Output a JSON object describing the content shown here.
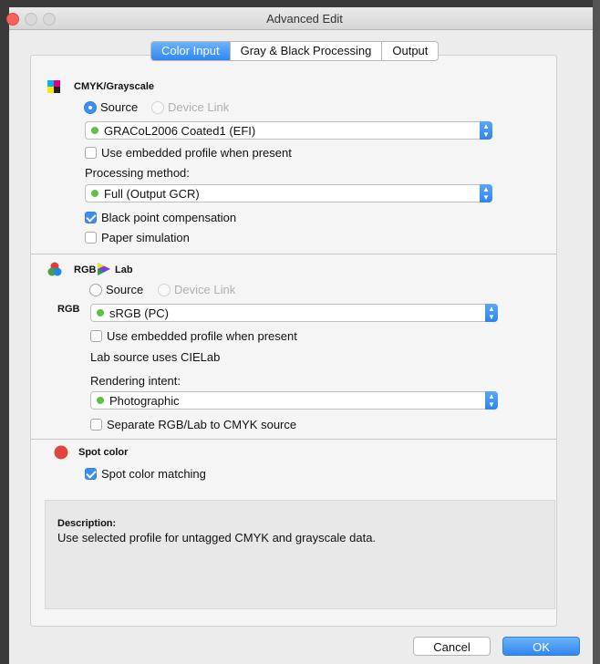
{
  "window": {
    "title": "Advanced Edit"
  },
  "tabs": [
    {
      "label": "Color Input",
      "active": true
    },
    {
      "label": "Gray & Black Processing",
      "active": false
    },
    {
      "label": "Output",
      "active": false
    }
  ],
  "cmyk": {
    "header": "CMYK/Grayscale",
    "source_label": "Source",
    "device_link_label": "Device Link",
    "profile": "GRACoL2006 Coated1 (EFI)",
    "use_embedded_label": "Use embedded profile when present",
    "use_embedded": false,
    "processing_method_label": "Processing method:",
    "processing_method": "Full (Output GCR)",
    "black_point_label": "Black point compensation",
    "black_point": true,
    "paper_sim_label": "Paper simulation",
    "paper_sim": false
  },
  "rgb": {
    "header_rgb": "RGB",
    "header_lab": "Lab",
    "source_label": "Source",
    "device_link_label": "Device Link",
    "row_label": "RGB",
    "profile": "sRGB (PC)",
    "use_embedded_label": "Use embedded profile when present",
    "lab_source_text": "Lab source uses CIELab",
    "rendering_intent_label": "Rendering intent:",
    "rendering_intent": "Photographic",
    "separate_label": "Separate RGB/Lab to CMYK source"
  },
  "spot": {
    "header": "Spot color",
    "matching_label": "Spot color matching",
    "matching": true
  },
  "description": {
    "title": "Description:",
    "text": "Use selected profile for untagged CMYK and grayscale data."
  },
  "buttons": {
    "cancel": "Cancel",
    "ok": "OK"
  },
  "colors": {
    "accent": "#3b8ff5",
    "spot": "#e0443c"
  }
}
